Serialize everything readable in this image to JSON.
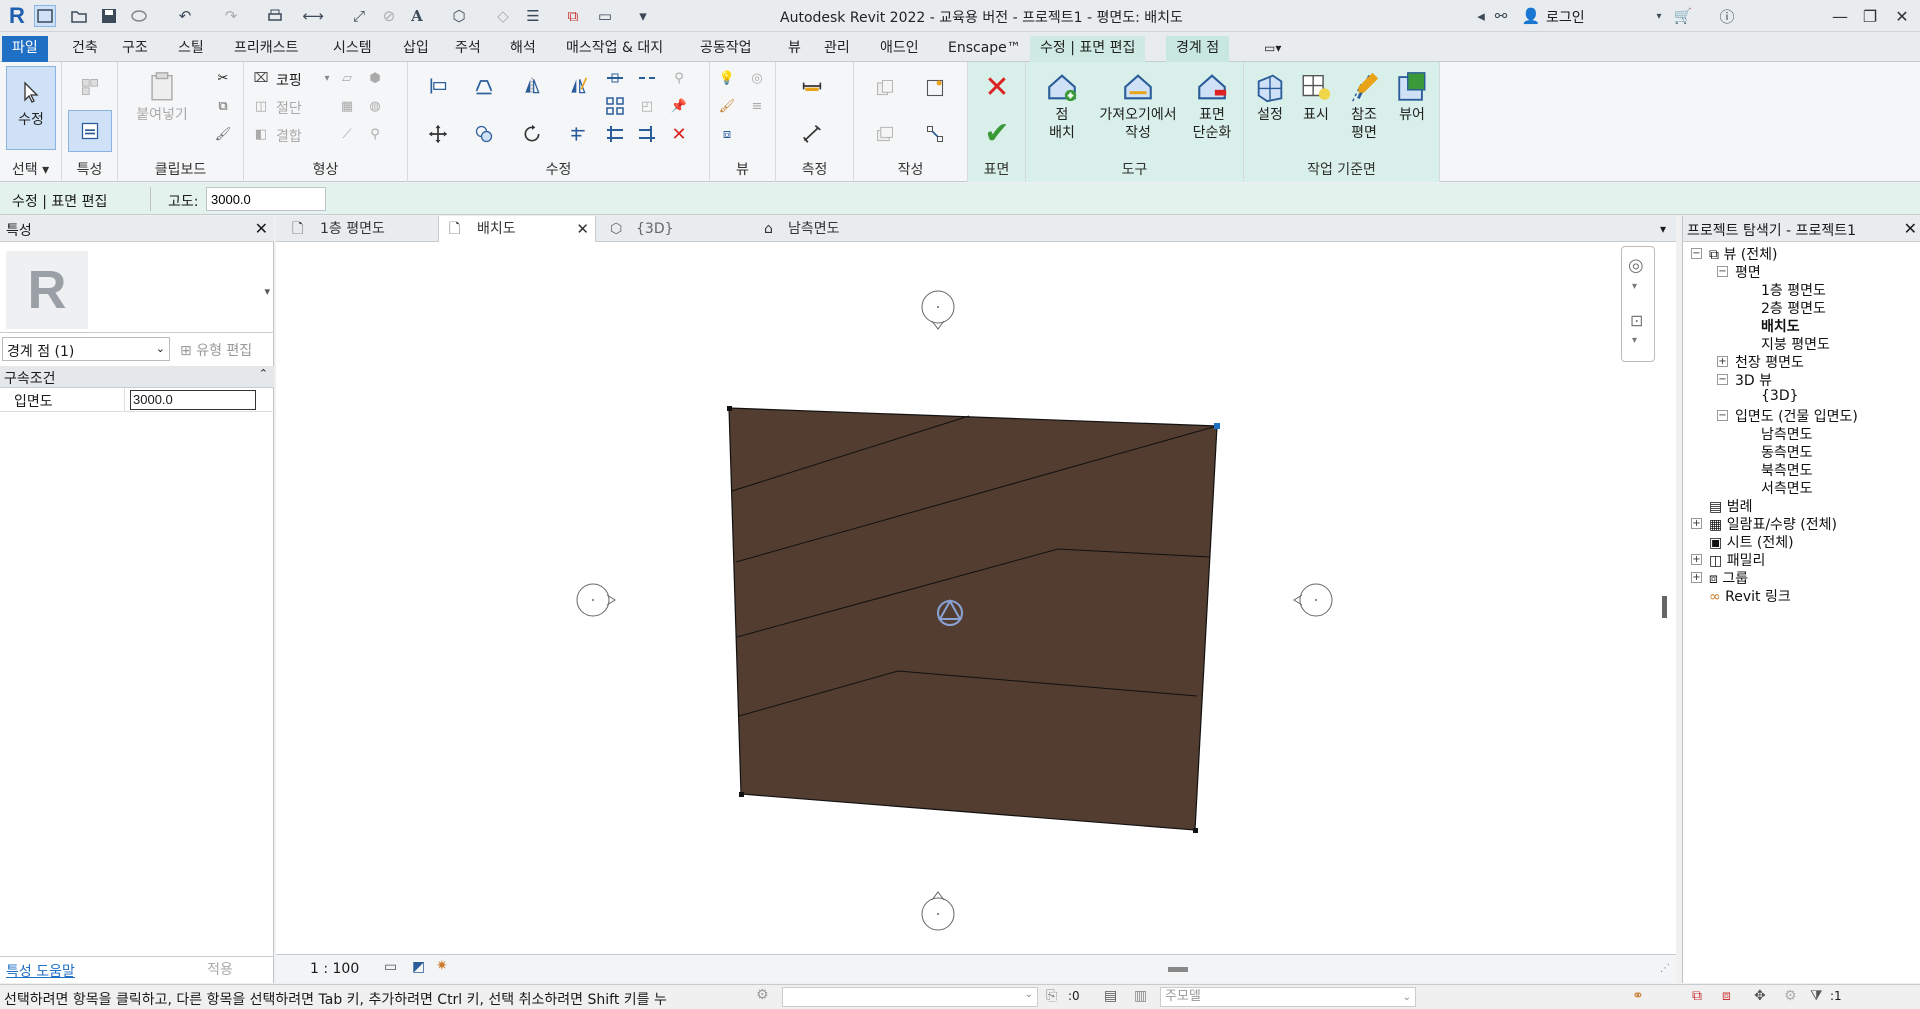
{
  "app": {
    "title": "Autodesk Revit 2022 - 교육용 버전 - 프로젝트1 - 평면도: 배치도",
    "login": "로그인"
  },
  "ribbon_tabs": [
    "파일",
    "건축",
    "구조",
    "스틸",
    "프리캐스트",
    "시스템",
    "삽입",
    "주석",
    "해석",
    "매스작업 & 대지",
    "공동작업",
    "뷰",
    "관리",
    "애드인",
    "Enscape™",
    "수정 | 표면 편집",
    "경계 점"
  ],
  "ribbon": {
    "modify_label": "수정",
    "copy_label": "코핑",
    "paste_label": "붙여넣기",
    "cut_label": "절단",
    "join_label": "결합",
    "place_point_label": "점\n배치",
    "import_label": "가져오기에서\n작성",
    "simplify_label": "표면\n단순화",
    "set_label": "설정",
    "show_label": "표시",
    "ref_plane_label": "참조\n평면",
    "viewer_label": "뷰어",
    "panels": {
      "select": "선택",
      "properties": "특성",
      "clipboard": "클립보드",
      "geometry": "형상",
      "modify": "수정",
      "view": "뷰",
      "measure": "측정",
      "create": "작성",
      "surface": "표면",
      "tools": "도구",
      "workplane": "작업 기준면"
    }
  },
  "options_bar": {
    "context": "수정 | 표면 편집",
    "elevation_label": "고도:",
    "elevation_value": "3000.0"
  },
  "properties": {
    "title": "특성",
    "type_selector": "경계 점 (1)",
    "edit_type": "유형 편집",
    "group": "구속조건",
    "param_name": "입면도",
    "param_value": "3000.0",
    "help_link": "특성 도움말",
    "apply": "적용"
  },
  "view_tabs": [
    {
      "label": "1층 평면도"
    },
    {
      "label": "배치도",
      "active": true
    },
    {
      "label": "{3D}"
    },
    {
      "label": "남측면도"
    }
  ],
  "view_status": {
    "scale": "1 : 100"
  },
  "project_browser": {
    "title": "프로젝트 탐색기 - 프로젝트1",
    "items": [
      {
        "label": "뷰 (전체)"
      },
      {
        "label": "평면"
      },
      {
        "label": "1층 평면도"
      },
      {
        "label": "2층 평면도"
      },
      {
        "label": "배치도"
      },
      {
        "label": "지붕 평면도"
      },
      {
        "label": "천장 평면도"
      },
      {
        "label": "3D 뷰"
      },
      {
        "label": "{3D}"
      },
      {
        "label": "입면도 (건물 입면도)"
      },
      {
        "label": "남측면도"
      },
      {
        "label": "동측면도"
      },
      {
        "label": "북측면도"
      },
      {
        "label": "서측면도"
      },
      {
        "label": "범례"
      },
      {
        "label": "일람표/수량 (전체)"
      },
      {
        "label": "시트 (전체)"
      },
      {
        "label": "패밀리"
      },
      {
        "label": "그룹"
      },
      {
        "label": "Revit 링크"
      }
    ]
  },
  "status_bar": {
    "message": "선택하려면 항목을 클릭하고, 다른 항목을 선택하려면 Tab 키, 추가하려면 Ctrl 키, 선택 취소하려면 Shift 키를 누",
    "workset_count": ":0",
    "design_option": "주모델",
    "filter_count": ":1"
  },
  "colors": {
    "accent": "#1f6fc5",
    "context_tab": "#cfeae3",
    "topo_surface": "#523d30"
  }
}
